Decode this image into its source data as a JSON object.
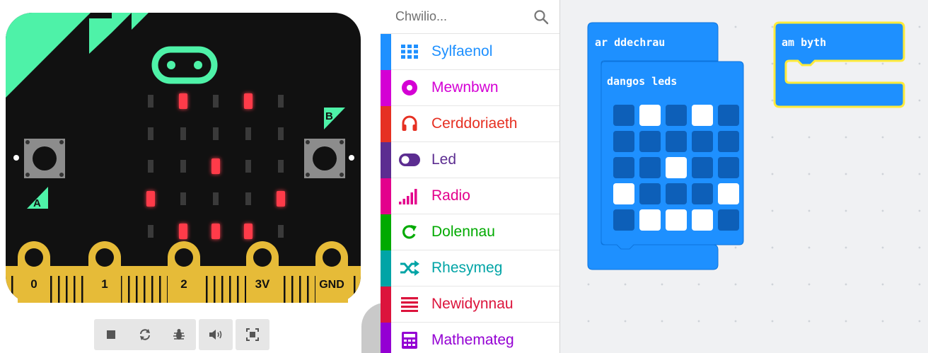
{
  "simulator": {
    "pins": [
      "0",
      "1",
      "2",
      "3V",
      "GND"
    ],
    "button_a": "A",
    "button_b": "B",
    "led_matrix": [
      [
        0,
        1,
        0,
        1,
        0
      ],
      [
        0,
        0,
        0,
        0,
        0
      ],
      [
        0,
        0,
        1,
        0,
        0
      ],
      [
        1,
        0,
        0,
        0,
        1
      ],
      [
        0,
        1,
        1,
        1,
        0
      ]
    ],
    "colors": {
      "board": "#111111",
      "accent": "#4ef2a8",
      "led_on": "#ff3b4a",
      "gold": "#e6bb38"
    },
    "controls": [
      "stop-icon",
      "restart-icon",
      "debug-icon",
      "sound-icon",
      "fullscreen-icon"
    ]
  },
  "toolbox": {
    "search_placeholder": "Chwilio...",
    "categories": [
      {
        "label": "Sylfaenol",
        "color": "#1e90ff",
        "icon": "grid-icon"
      },
      {
        "label": "Mewnbwn",
        "color": "#d400d4",
        "icon": "target-icon"
      },
      {
        "label": "Cerddoriaeth",
        "color": "#e63022",
        "icon": "headphones-icon"
      },
      {
        "label": "Led",
        "color": "#5c2d91",
        "icon": "toggle-icon"
      },
      {
        "label": "Radio",
        "color": "#e3008c",
        "icon": "signal-icon"
      },
      {
        "label": "Dolennau",
        "color": "#00aa00",
        "icon": "loop-icon"
      },
      {
        "label": "Rhesymeg",
        "color": "#00a4a6",
        "icon": "shuffle-icon"
      },
      {
        "label": "Newidynnau",
        "color": "#dc143c",
        "icon": "list-icon"
      },
      {
        "label": "Mathemateg",
        "color": "#9400d3",
        "icon": "calculator-icon"
      }
    ]
  },
  "workspace": {
    "on_start_label": "ar ddechrau",
    "show_leds_label": "dangos leds",
    "forever_label": "am byth",
    "show_leds_grid": [
      [
        0,
        1,
        0,
        1,
        0
      ],
      [
        0,
        0,
        0,
        0,
        0
      ],
      [
        0,
        0,
        1,
        0,
        0
      ],
      [
        1,
        0,
        0,
        0,
        1
      ],
      [
        0,
        1,
        1,
        1,
        0
      ]
    ],
    "colors": {
      "block": "#1e90ff",
      "block_border": "#0d74dc",
      "forever_outline": "#ffeb3b",
      "cell_off": "#0d5fb8",
      "cell_on": "#ffffff"
    }
  }
}
